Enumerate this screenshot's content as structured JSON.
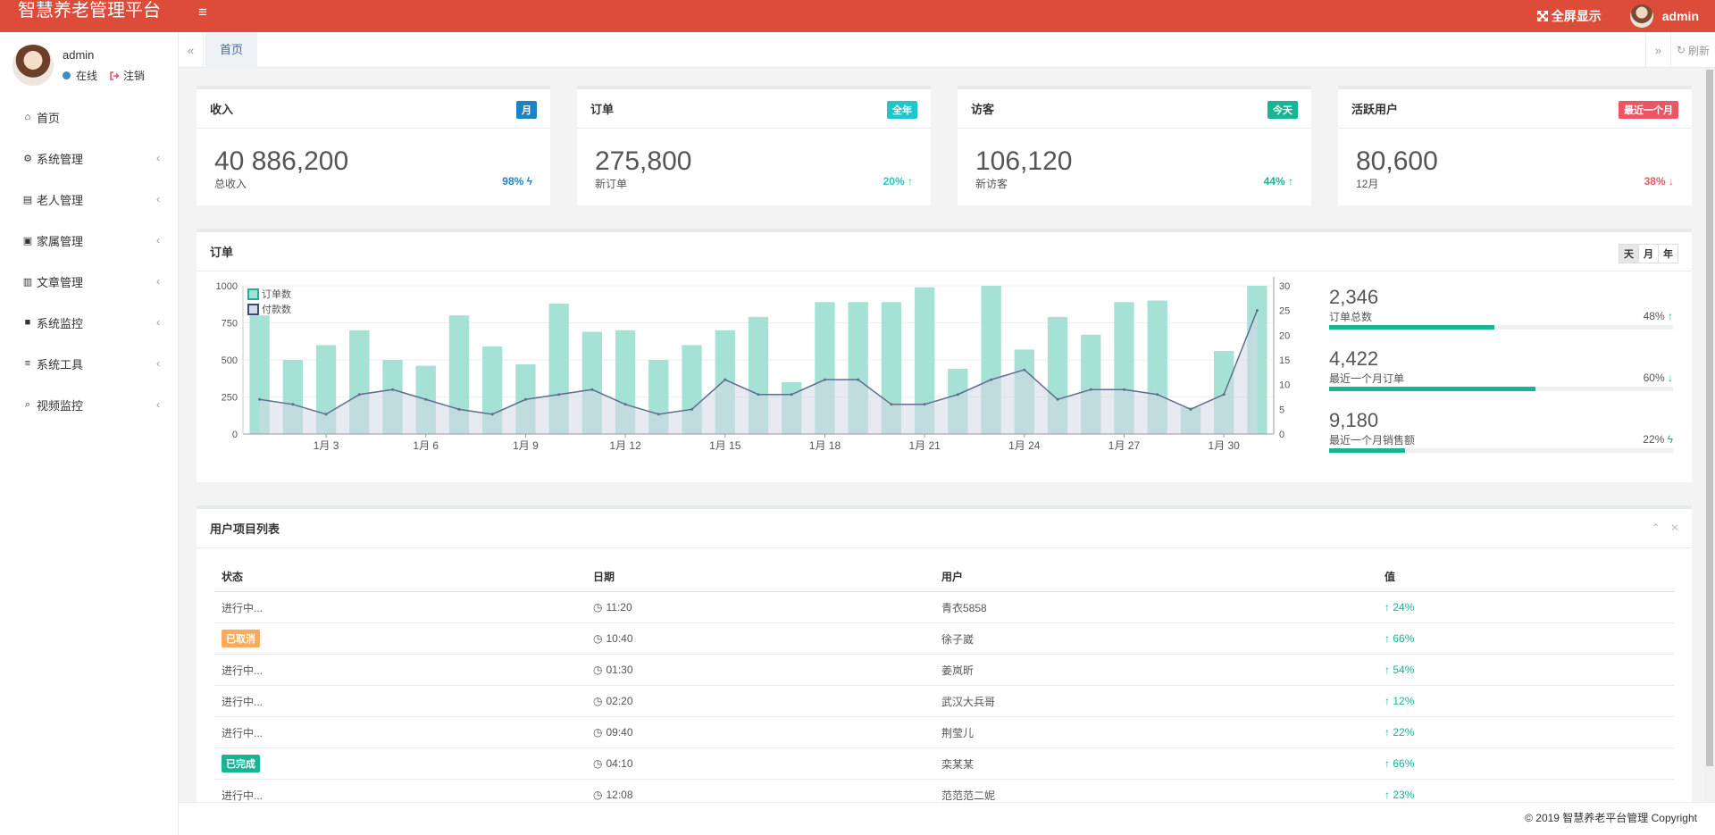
{
  "app": {
    "title": "智慧养老管理平台"
  },
  "header": {
    "fullscreen_label": "全屏显示",
    "user_name": "admin"
  },
  "sidebar": {
    "user": {
      "name": "admin",
      "status": "在线",
      "logout": "注销"
    },
    "items": [
      {
        "label": "首页",
        "icon": "home-icon"
      },
      {
        "label": "系统管理",
        "icon": "gear-icon"
      },
      {
        "label": "老人管理",
        "icon": "id-card-icon"
      },
      {
        "label": "家属管理",
        "icon": "contact-icon"
      },
      {
        "label": "文章管理",
        "icon": "book-icon"
      },
      {
        "label": "系统监控",
        "icon": "video-camera-icon"
      },
      {
        "label": "系统工具",
        "icon": "list-icon"
      },
      {
        "label": "视频监控",
        "icon": "search-icon"
      }
    ]
  },
  "tabs": {
    "home": "首页",
    "refresh": "刷新"
  },
  "stats": [
    {
      "title": "收入",
      "badge": "月",
      "badge_color": "#1c84c6",
      "value": "40 886,200",
      "sub": "总收入",
      "pct": "98%",
      "pct_color": "#1c84c6",
      "arrow": "bolt"
    },
    {
      "title": "订单",
      "badge": "全年",
      "badge_color": "#23c6c8",
      "value": "275,800",
      "sub": "新订单",
      "pct": "20%",
      "pct_color": "#23c6c8",
      "arrow": "up"
    },
    {
      "title": "访客",
      "badge": "今天",
      "badge_color": "#1ab394",
      "value": "106,120",
      "sub": "新访客",
      "pct": "44%",
      "pct_color": "#1ab394",
      "arrow": "up"
    },
    {
      "title": "活跃用户",
      "badge": "最近一个月",
      "badge_color": "#ed5565",
      "value": "80,600",
      "sub": "12月",
      "pct": "38%",
      "pct_color": "#ed5565",
      "arrow": "down"
    }
  ],
  "orders_panel": {
    "title": "订单",
    "ranges": [
      "天",
      "月",
      "年"
    ],
    "side_stats": [
      {
        "value": "2,346",
        "label": "订单总数",
        "pct": "48%",
        "progress": 0.48,
        "arrow": "up"
      },
      {
        "value": "4,422",
        "label": "最近一个月订单",
        "pct": "60%",
        "progress": 0.6,
        "arrow": "down"
      },
      {
        "value": "9,180",
        "label": "最近一个月销售额",
        "pct": "22%",
        "progress": 0.22,
        "arrow": "bolt"
      }
    ]
  },
  "chart_data": {
    "type": "bar",
    "x": [
      1,
      2,
      3,
      4,
      5,
      6,
      7,
      8,
      9,
      10,
      11,
      12,
      13,
      14,
      15,
      16,
      17,
      18,
      19,
      20,
      21,
      22,
      23,
      24,
      25,
      26,
      27,
      28,
      29,
      30,
      31
    ],
    "x_tick_labels": [
      "1月 3",
      "1月 6",
      "1月 9",
      "1月 12",
      "1月 15",
      "1月 18",
      "1月 21",
      "1月 24",
      "1月 27",
      "1月 30"
    ],
    "x_tick_positions": [
      3,
      6,
      9,
      12,
      15,
      18,
      21,
      24,
      27,
      30
    ],
    "series": [
      {
        "name": "订单数",
        "type": "bar",
        "axis": "left",
        "color": "#a6e1d6",
        "values": [
          800,
          500,
          600,
          700,
          500,
          460,
          800,
          590,
          470,
          880,
          690,
          700,
          500,
          600,
          700,
          790,
          350,
          890,
          890,
          890,
          990,
          440,
          1000,
          570,
          790,
          670,
          890,
          900,
          180,
          560,
          1000
        ]
      },
      {
        "name": "付款数",
        "type": "area",
        "axis": "right",
        "color": "#5e6e8c",
        "fill": "#d5d9e8",
        "values": [
          7,
          6,
          4,
          8,
          9,
          7,
          5,
          4,
          7,
          8,
          9,
          6,
          4,
          5,
          11,
          8,
          8,
          11,
          11,
          6,
          6,
          8,
          11,
          13,
          7,
          9,
          9,
          8,
          5,
          8,
          25
        ]
      }
    ],
    "yleft": {
      "ticks": [
        0,
        250,
        500,
        750,
        1000
      ],
      "lim": [
        0,
        1000
      ]
    },
    "yright": {
      "ticks": [
        0,
        5,
        10,
        15,
        20,
        25,
        30
      ],
      "lim": [
        0,
        30
      ]
    },
    "legend": "top-left",
    "grid": true
  },
  "table": {
    "title": "用户项目列表",
    "headers": [
      "状态",
      "日期",
      "用户",
      "值"
    ],
    "rows": [
      {
        "status": "进行中...",
        "badge": "",
        "time": "11:20",
        "user": "青衣5858",
        "value": "24%"
      },
      {
        "status": "已取消",
        "badge": "#f8ac59",
        "time": "10:40",
        "user": "徐子崴",
        "value": "66%"
      },
      {
        "status": "进行中...",
        "badge": "",
        "time": "01:30",
        "user": "姜岚昕",
        "value": "54%"
      },
      {
        "status": "进行中...",
        "badge": "",
        "time": "02:20",
        "user": "武汉大兵哥",
        "value": "12%"
      },
      {
        "status": "进行中...",
        "badge": "",
        "time": "09:40",
        "user": "荆莹儿",
        "value": "22%"
      },
      {
        "status": "已完成",
        "badge": "#1ab394",
        "time": "04:10",
        "user": "栾某某",
        "value": "66%"
      },
      {
        "status": "进行中...",
        "badge": "",
        "time": "12:08",
        "user": "范范范二妮",
        "value": "23%"
      }
    ]
  },
  "footer": {
    "copyright": "© 2019 智慧养老平台管理 Copyright"
  }
}
